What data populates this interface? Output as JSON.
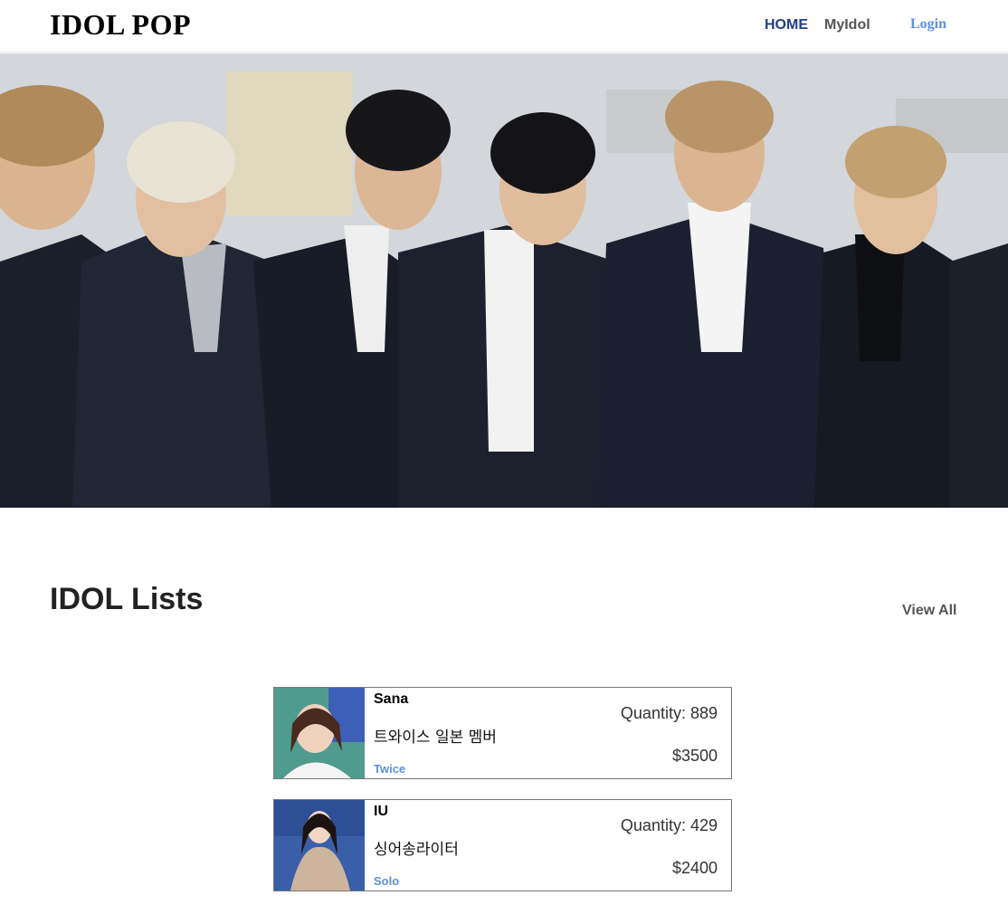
{
  "header": {
    "brand": "IDOL POP",
    "nav": {
      "home": "HOME",
      "myidol": "MyIdol",
      "login": "Login"
    }
  },
  "hero": {
    "image": "group-photo"
  },
  "section": {
    "title": "IDOL Lists",
    "view_all": "View All"
  },
  "idols": [
    {
      "name": "Sana",
      "description": "트와이스 일본 멤버",
      "group": "Twice",
      "quantity": "Quantity: 889",
      "price": "$3500"
    },
    {
      "name": "IU",
      "description": "싱어송라이터",
      "group": "Solo",
      "quantity": "Quantity: 429",
      "price": "$2400"
    }
  ],
  "colors": {
    "accent": "#5b8fe3",
    "home_active": "#1f3d8a",
    "text_muted": "#555555"
  }
}
